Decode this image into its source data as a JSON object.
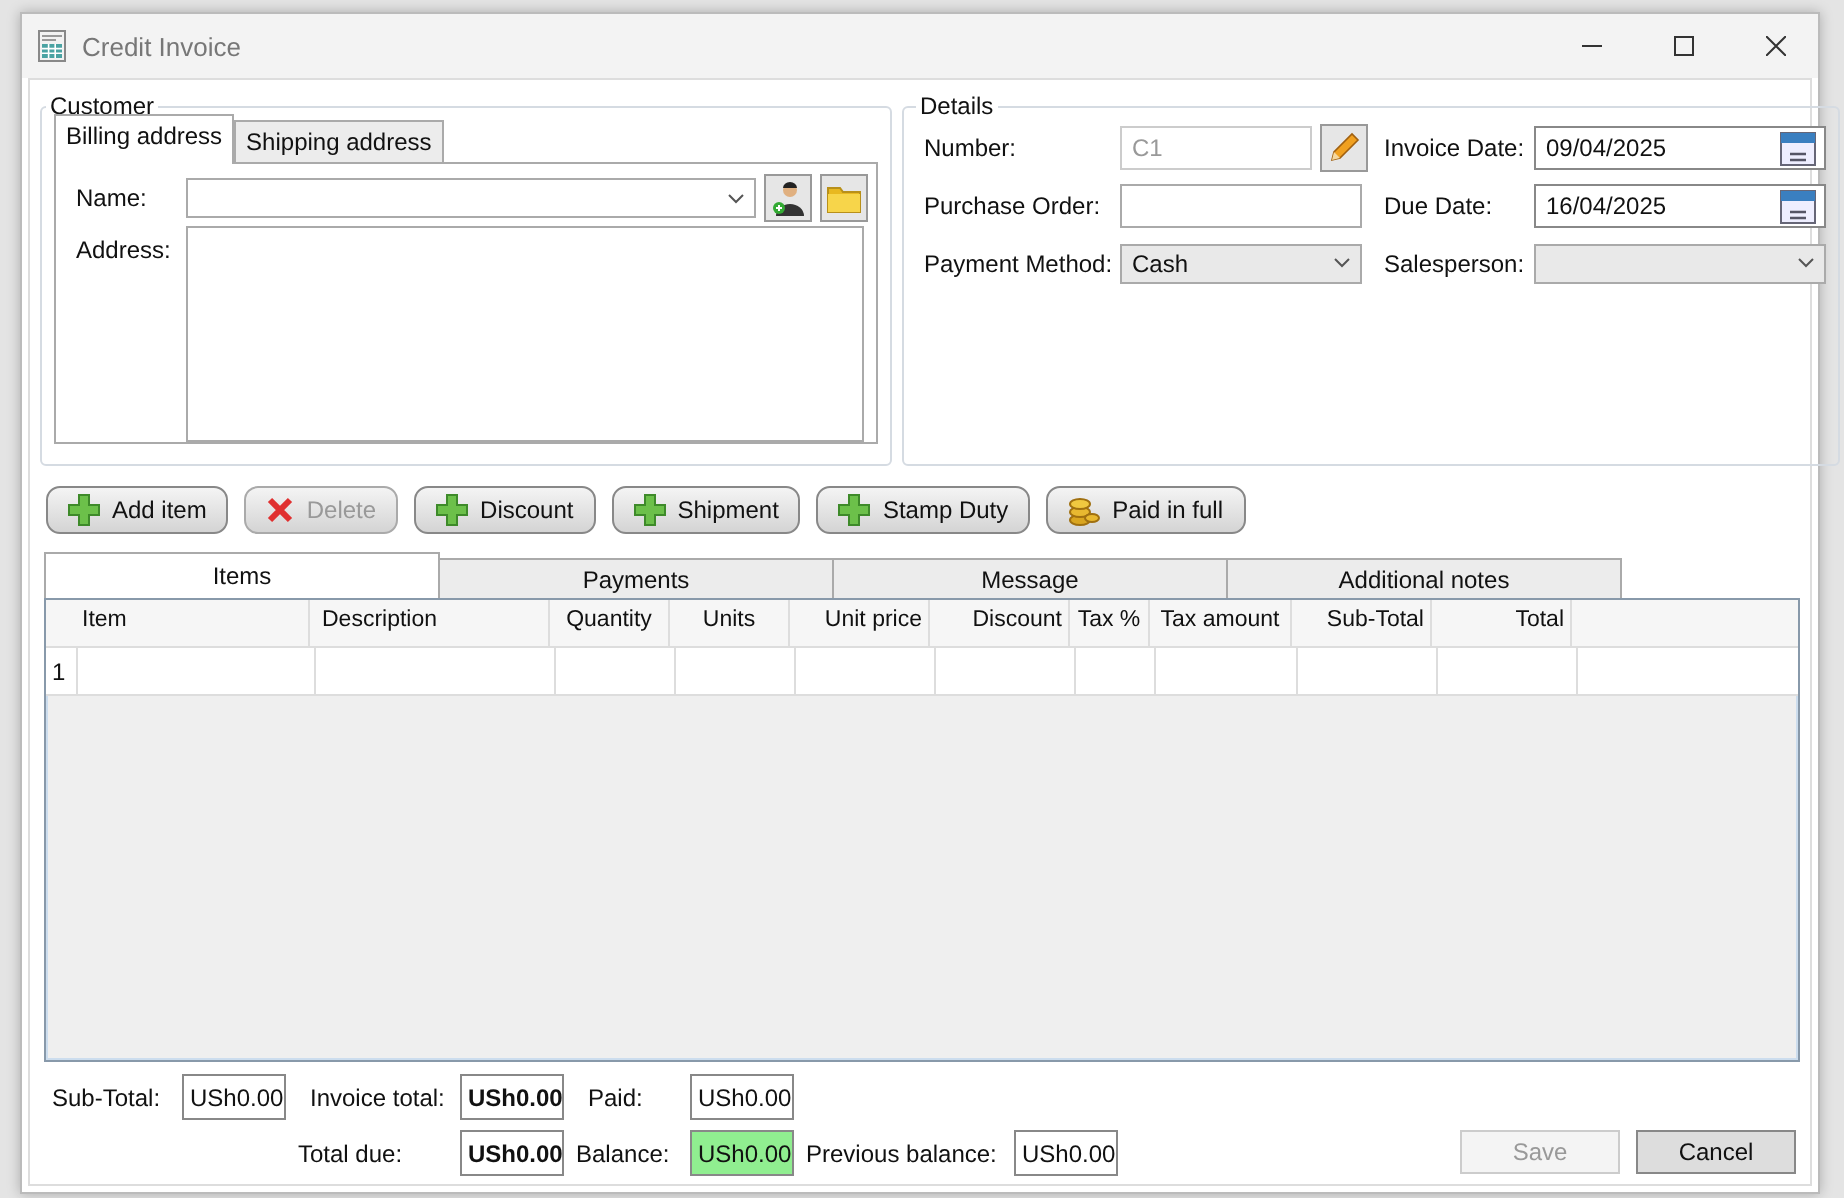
{
  "window": {
    "title": "Credit Invoice"
  },
  "customer": {
    "title": "Customer",
    "tabs": [
      {
        "label": "Billing address",
        "selected": true
      },
      {
        "label": "Shipping address",
        "selected": false
      }
    ],
    "name_label": "Name:",
    "address_label": "Address:"
  },
  "details": {
    "title": "Details",
    "fields_left": [
      {
        "label": "Number:",
        "kind": "locked",
        "value": "C1",
        "disabled": true
      },
      {
        "label": "Purchase Order:",
        "kind": "text"
      },
      {
        "label": "Payment Method:",
        "kind": "dropdown",
        "value": "Cash"
      }
    ],
    "fields_right": [
      {
        "label": "Invoice Date:",
        "kind": "date",
        "value": "09/04/2025"
      },
      {
        "label": "Due Date:",
        "kind": "date",
        "value": "16/04/2025"
      },
      {
        "label": "Salesperson:",
        "kind": "dropdown"
      }
    ]
  },
  "toolbar": [
    {
      "label": "Add item",
      "kind": "plus",
      "disabled": false
    },
    {
      "label": "Delete",
      "kind": "cross",
      "disabled": true
    },
    {
      "label": "Discount",
      "kind": "plus",
      "disabled": false
    },
    {
      "label": "Shipment",
      "kind": "plus",
      "disabled": false
    },
    {
      "label": "Stamp Duty",
      "kind": "plus",
      "disabled": false
    },
    {
      "label": "Paid in full",
      "kind": "coins",
      "disabled": false
    }
  ],
  "tabs": [
    {
      "label": "Items",
      "selected": true
    },
    {
      "label": "Payments",
      "selected": false
    },
    {
      "label": "Message",
      "selected": false
    },
    {
      "label": "Additional notes",
      "selected": false
    }
  ],
  "grid": {
    "columns": [
      {
        "label": "Item"
      },
      {
        "label": "Description"
      },
      {
        "label": "Quantity"
      },
      {
        "label": "Units"
      },
      {
        "label": "Unit price"
      },
      {
        "label": "Discount"
      },
      {
        "label": "Tax %"
      },
      {
        "label": "Tax amount"
      },
      {
        "label": "Sub-Total"
      },
      {
        "label": "Total"
      }
    ],
    "rows": [
      {
        "header": "1"
      }
    ]
  },
  "totals": [
    [
      {
        "label": "Sub-Total:",
        "value": "USh0.00",
        "bold": false,
        "highlighted": false
      },
      {
        "label": "Invoice total:",
        "value": "USh0.00",
        "bold": true,
        "highlighted": false
      },
      {
        "label": "Paid:",
        "value": "USh0.00",
        "bold": false,
        "highlighted": false
      }
    ],
    [
      {
        "label": "Total due:",
        "value": "USh0.00",
        "bold": true,
        "highlighted": false
      },
      {
        "label": "Balance:",
        "value": "USh0.00",
        "bold": false,
        "highlighted": true
      },
      {
        "label": "Previous balance:",
        "value": "USh0.00",
        "bold": false,
        "highlighted": false
      }
    ]
  ],
  "buttons": [
    {
      "label": "Save",
      "disabled": true
    },
    {
      "label": "Cancel",
      "disabled": false
    }
  ]
}
